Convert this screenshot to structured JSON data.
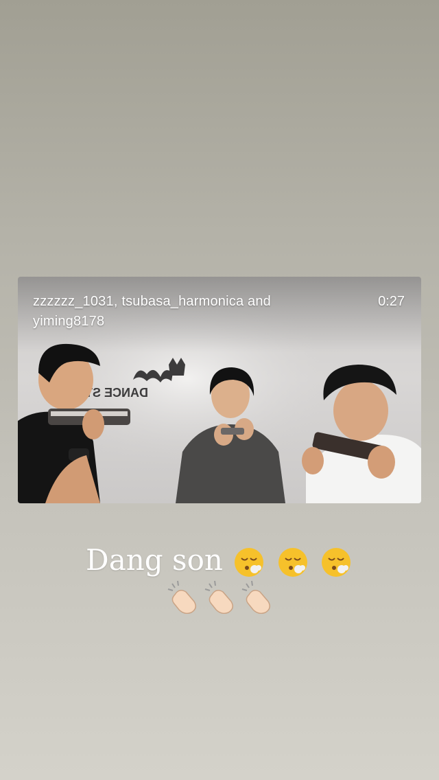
{
  "video": {
    "caption": "zzzzzz_1031, tsubasa_harmonica and yiming8178",
    "duration": "0:27",
    "studio_logo_text": "DANCE STUDIO"
  },
  "story": {
    "text": "Dang son",
    "face_emoji": "face-exhaling-icon",
    "face_emoji_count": 3,
    "clap_emoji": "clapping-hands-icon",
    "clap_emoji_count": 3
  }
}
